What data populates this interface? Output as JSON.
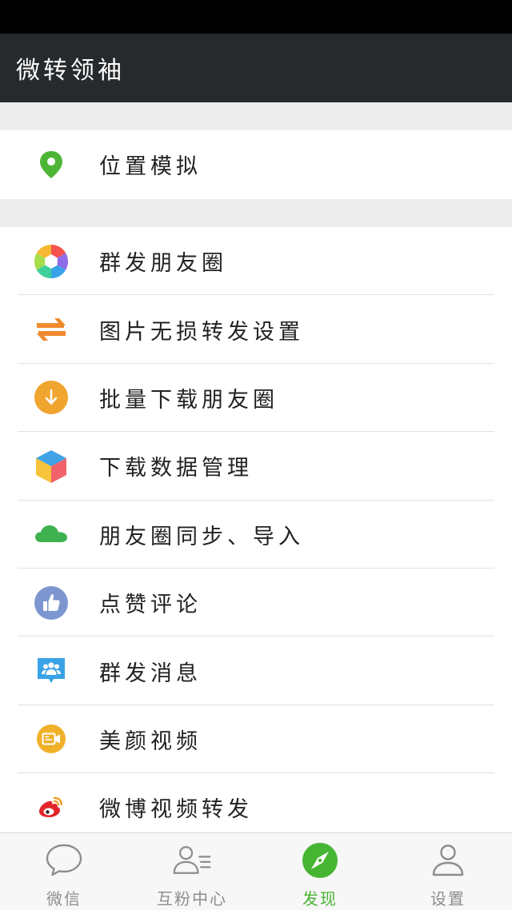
{
  "app": {
    "title": "微转领袖"
  },
  "menu_top": [
    {
      "label": "位置模拟",
      "icon": "location-pin-icon"
    }
  ],
  "menu_main": [
    {
      "label": "群发朋友圈",
      "icon": "camera-aperture-icon"
    },
    {
      "label": "图片无损转发设置",
      "icon": "transfer-arrows-icon"
    },
    {
      "label": "批量下载朋友圈",
      "icon": "download-circle-icon"
    },
    {
      "label": "下载数据管理",
      "icon": "cube-icon"
    },
    {
      "label": "朋友圈同步、导入",
      "icon": "cloud-icon"
    },
    {
      "label": "点赞评论",
      "icon": "thumbs-up-icon"
    },
    {
      "label": "群发消息",
      "icon": "group-message-icon"
    },
    {
      "label": "美颜视频",
      "icon": "video-camera-icon"
    },
    {
      "label": "微博视频转发",
      "icon": "weibo-icon"
    }
  ],
  "tabs": [
    {
      "label": "微信",
      "icon": "chat-bubble-icon",
      "active": false
    },
    {
      "label": "互粉中心",
      "icon": "contacts-icon",
      "active": false
    },
    {
      "label": "发现",
      "icon": "compass-icon",
      "active": true
    },
    {
      "label": "设置",
      "icon": "person-icon",
      "active": false
    }
  ],
  "colors": {
    "accent": "#46b532",
    "appbar": "#272a2c",
    "background": "#ededed"
  }
}
